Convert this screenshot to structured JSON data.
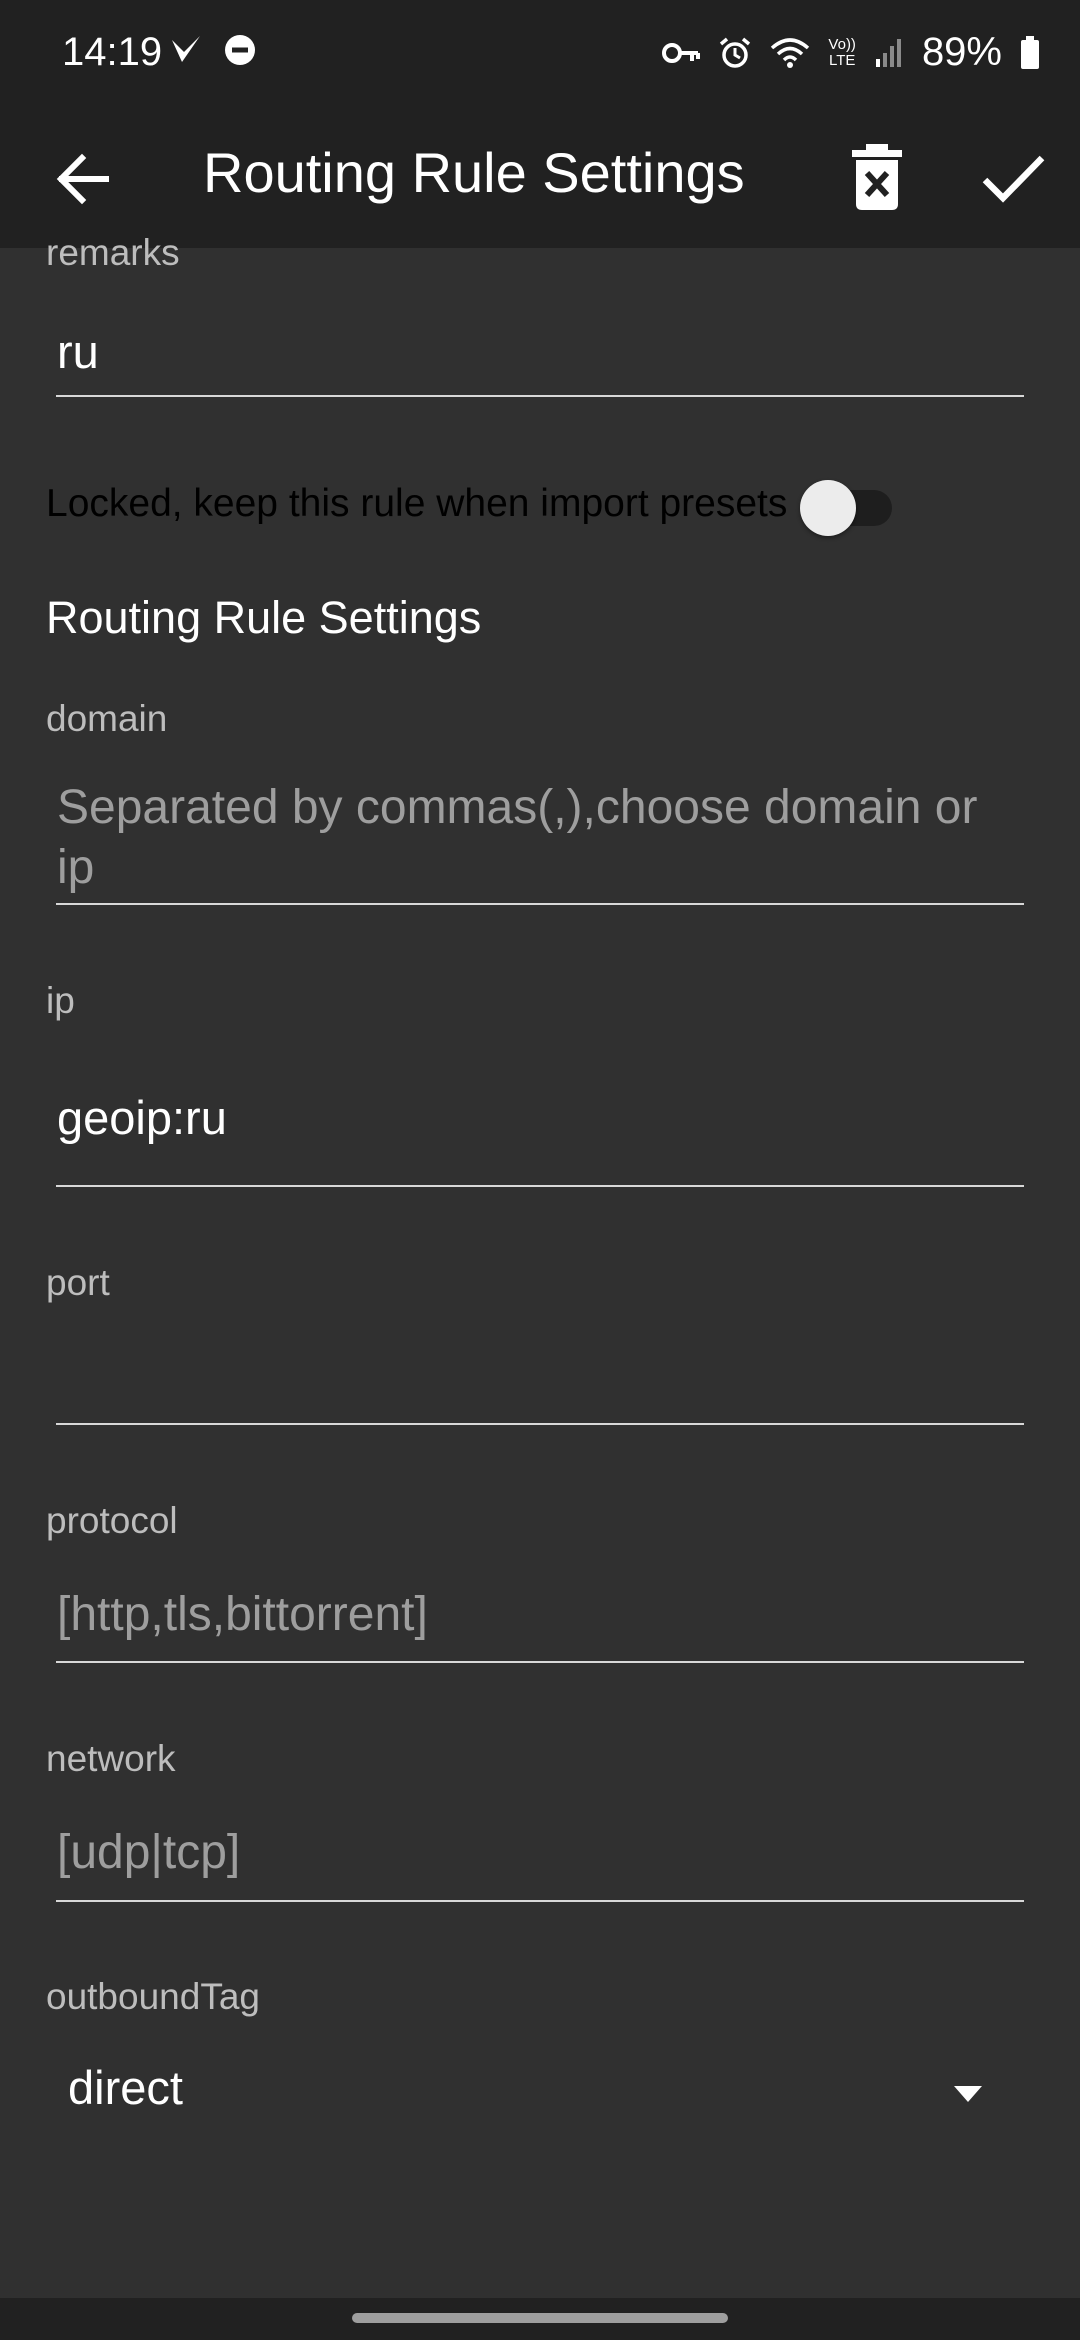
{
  "status_bar": {
    "time": "14:19",
    "battery_text": "89%",
    "icons": [
      "navigation-icon",
      "dnd-icon",
      "vpn-key-icon",
      "alarm-icon",
      "wifi-icon",
      "volte-icon",
      "signal-icon",
      "battery-icon"
    ],
    "volte_top": "Vo))",
    "volte_bottom": "LTE"
  },
  "app_bar": {
    "title": "Routing Rule Settings",
    "icons": [
      "back-arrow-icon",
      "delete-icon",
      "checkmark-icon"
    ]
  },
  "form": {
    "remarks_label": "remarks",
    "remarks_value": "ru",
    "locked_label": "Locked, keep this rule when import presets",
    "locked_on": false,
    "section_title": "Routing Rule Settings",
    "domain_label": "domain",
    "domain_placeholder": "Separated by commas(,),choose domain or ip",
    "ip_label": "ip",
    "ip_value": "geoip:ru",
    "port_label": "port",
    "port_value": "",
    "protocol_label": "protocol",
    "protocol_placeholder": "[http,tls,bittorrent]",
    "network_label": "network",
    "network_placeholder": "[udp|tcp]",
    "outbound_label": "outboundTag",
    "outbound_value": "direct"
  },
  "colors": {
    "background": "#303030",
    "toolbar": "#212121",
    "label": "#bdbdbd",
    "placeholder": "#9e9e9e",
    "underline": "#d8d8d8"
  }
}
